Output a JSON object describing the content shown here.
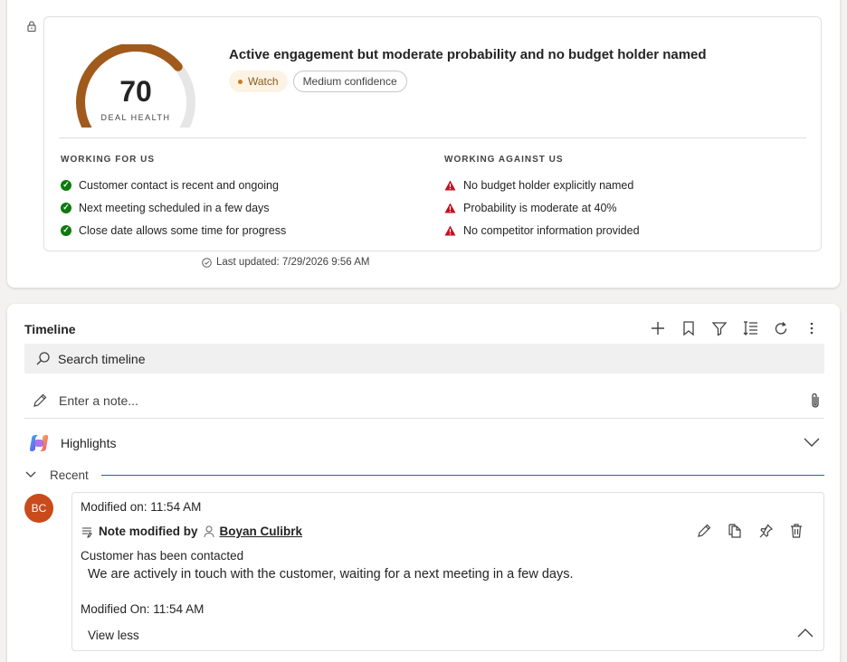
{
  "deal_health": {
    "score": "70",
    "score_label": "DEAL HEALTH",
    "score_value": 70,
    "headline": "Active engagement but moderate probability and no budget holder named",
    "status_badge": "Watch",
    "confidence_badge": "Medium confidence",
    "working_for_title": "WORKING FOR US",
    "working_for": [
      "Customer contact is recent and ongoing",
      "Next meeting scheduled in a few days",
      "Close date allows some time for progress"
    ],
    "working_against_title": "WORKING AGAINST US",
    "working_against": [
      "No budget holder explicitly named",
      "Probability is moderate at 40%",
      "No competitor information provided"
    ],
    "last_updated": "Last updated: 7/29/2026 9:56 AM",
    "colors": {
      "gauge_fill": "#a05a1c",
      "gauge_track": "#e6e6e6",
      "positive": "#0e7a0d",
      "negative": "#c50f1f"
    }
  },
  "timeline": {
    "title": "Timeline",
    "search_placeholder": "Search timeline",
    "note_placeholder": "Enter a note...",
    "highlights_label": "Highlights",
    "recent_label": "Recent",
    "entry": {
      "avatar_initials": "BC",
      "modified_on": "Modified on: 11:54 AM",
      "title_prefix": "Note modified by",
      "author": "Boyan Culibrk",
      "subject": "Customer has been contacted",
      "body": "We are actively in touch with the customer, waiting for a next meeting in a few days.",
      "modified_on_footer": "Modified On: 11:54 AM",
      "view_less": "View less"
    }
  }
}
